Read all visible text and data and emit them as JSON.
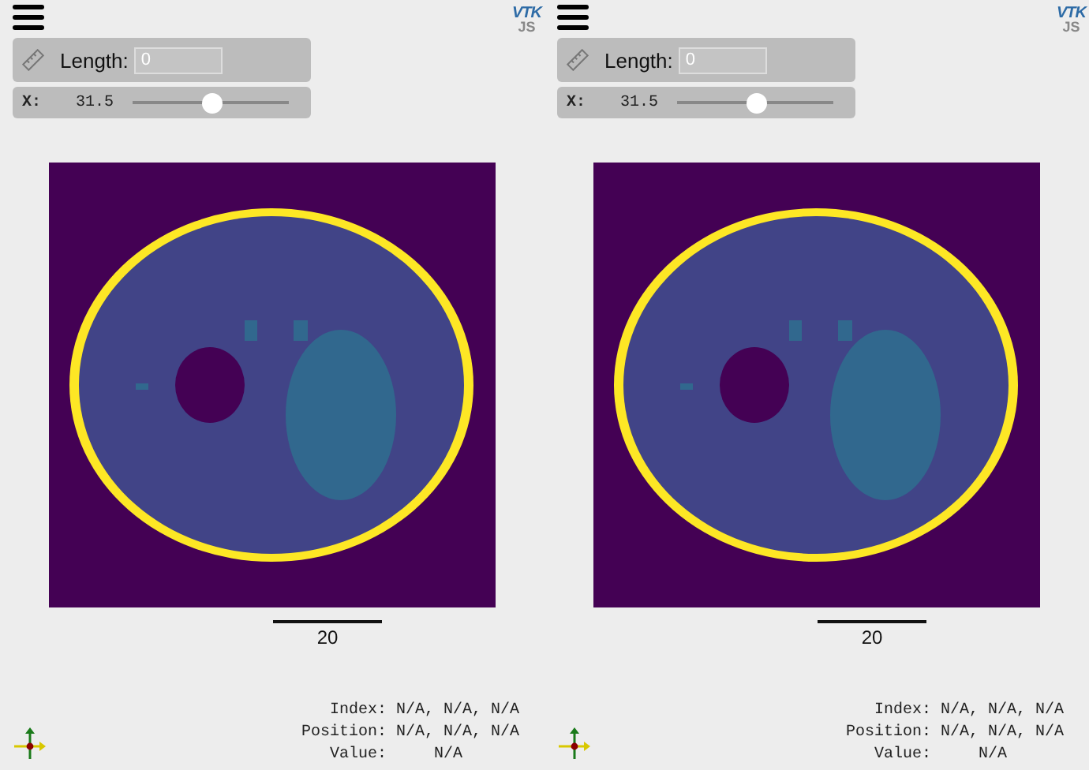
{
  "panels": [
    {
      "logo": {
        "top": "VTK",
        "bottom": "JS"
      },
      "length_tool": {
        "label": "Length:",
        "value": "0"
      },
      "slider": {
        "axis": "X:",
        "reading": "31.5",
        "level": 0.51
      },
      "scale_bar": {
        "label": "20"
      },
      "info": [
        {
          "label": "Index:",
          "value": "N/A, N/A, N/A"
        },
        {
          "label": "Position:",
          "value": "N/A, N/A, N/A"
        },
        {
          "label": "Value:",
          "value": "    N/A"
        }
      ]
    },
    {
      "logo": {
        "top": "VTK",
        "bottom": "JS"
      },
      "length_tool": {
        "label": "Length:",
        "value": "0"
      },
      "slider": {
        "axis": "X:",
        "reading": "31.5",
        "level": 0.51
      },
      "scale_bar": {
        "label": "20"
      },
      "info": [
        {
          "label": "Index:",
          "value": "N/A, N/A, N/A"
        },
        {
          "label": "Position:",
          "value": "N/A, N/A, N/A"
        },
        {
          "label": "Value:",
          "value": "    N/A"
        }
      ]
    }
  ]
}
